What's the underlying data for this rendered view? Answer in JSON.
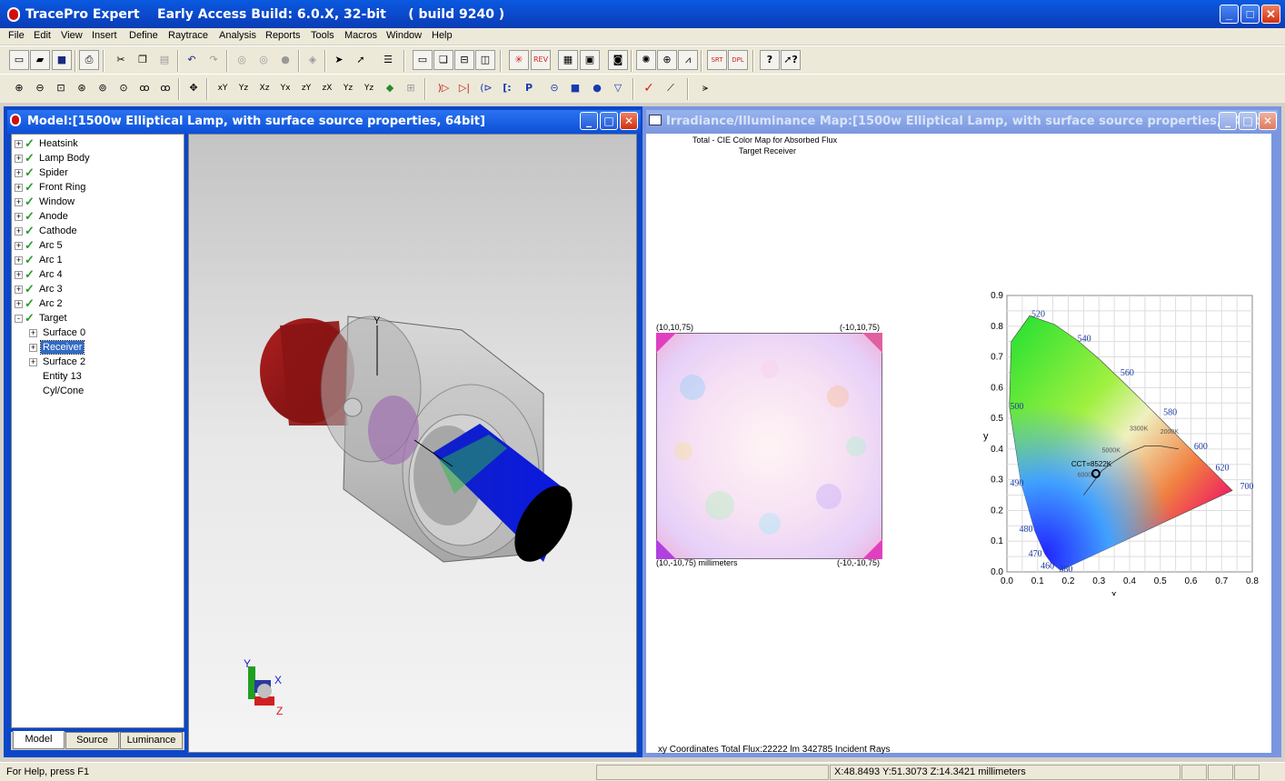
{
  "app": {
    "title": "TracePro Expert    Early Access Build: 6.0.X, 32-bit     ( build 9240 )"
  },
  "menu": [
    "File",
    "Edit",
    "View",
    "Insert",
    "Define",
    "Raytrace",
    "Analysis",
    "Reports",
    "Tools",
    "Macros",
    "Window",
    "Help"
  ],
  "toolbar1": [
    "new-icon",
    "open-icon",
    "save-icon",
    "print-icon",
    "cut-icon",
    "copy-icon",
    "paste-icon",
    "undo-icon",
    "redo-icon",
    "boolean-union-icon",
    "boolean-intersect-icon",
    "boolean-subtract-icon",
    "move-icon",
    "select-icon",
    "select-surface-icon",
    "properties-icon",
    "window-icon",
    "cascade-icon",
    "tile-horizontal-icon",
    "tile-vertical-icon",
    "trace-rays-icon",
    "reverse-ray-icon",
    "grid-icon",
    "raytrace-icon",
    "irradiance-icon",
    "analysis-icon",
    "target-icon",
    "chart-icon",
    "srt-icon",
    "dpl-icon",
    "help-icon",
    "context-help-icon"
  ],
  "toolbar2": [
    "zoom-in-icon",
    "zoom-out-icon",
    "zoom-window-icon",
    "zoom-all-icon",
    "zoom-fit-icon",
    "zoom-selected-icon",
    "glasses-icon",
    "glasses-stereo-icon",
    "pan-icon",
    "view-xy-icon",
    "view-yz-icon",
    "view-xz-icon",
    "view-yx-icon",
    "view-zy-icon",
    "view-zx-icon",
    "view-iso-icon",
    "view-iso2-icon",
    "render-icon",
    "disabled-icon",
    "lens-icon",
    "mirror-icon",
    "lens-group-icon",
    "bracket-icon",
    "prism-icon",
    "cylinder-icon",
    "block-icon",
    "sphere-icon",
    "cone-icon",
    "check-icon",
    "ruler-icon",
    "trim-icon"
  ],
  "tb2labels": {
    "xy": "xY",
    "yz": "Yz",
    "xz": "Xz",
    "yx": "Yx",
    "zy": "zY",
    "zx": "zX",
    "iso": "Yz",
    "iso2": "Yz",
    "bracket": "[:",
    "prism": "P"
  },
  "model_window": {
    "title": "Model:[1500w Elliptical Lamp, with surface source properties, 64bit]",
    "tree": [
      {
        "label": "Heatsink",
        "level": 0,
        "check": true,
        "expand": "+"
      },
      {
        "label": "Lamp Body",
        "level": 0,
        "check": true,
        "expand": "+"
      },
      {
        "label": "Spider",
        "level": 0,
        "check": true,
        "expand": "+"
      },
      {
        "label": "Front Ring",
        "level": 0,
        "check": true,
        "expand": "+"
      },
      {
        "label": "Window",
        "level": 0,
        "check": true,
        "expand": "+"
      },
      {
        "label": "Anode",
        "level": 0,
        "check": true,
        "expand": "+"
      },
      {
        "label": "Cathode",
        "level": 0,
        "check": true,
        "expand": "+"
      },
      {
        "label": "Arc 5",
        "level": 0,
        "check": true,
        "expand": "+"
      },
      {
        "label": "Arc 1",
        "level": 0,
        "check": true,
        "expand": "+"
      },
      {
        "label": "Arc 4",
        "level": 0,
        "check": true,
        "expand": "+"
      },
      {
        "label": "Arc 3",
        "level": 0,
        "check": true,
        "expand": "+"
      },
      {
        "label": "Arc 2",
        "level": 0,
        "check": true,
        "expand": "+"
      },
      {
        "label": "Target",
        "level": 0,
        "check": true,
        "expand": "-"
      },
      {
        "label": "Surface 0",
        "level": 1,
        "check": false,
        "expand": "+"
      },
      {
        "label": "Receiver",
        "level": 1,
        "check": false,
        "expand": "+",
        "selected": true
      },
      {
        "label": "Surface 2",
        "level": 1,
        "check": false,
        "expand": "+"
      },
      {
        "label": "Entity 13",
        "level": 1,
        "check": false,
        "expand": ""
      },
      {
        "label": "Cyl/Cone",
        "level": 1,
        "check": false,
        "expand": ""
      }
    ],
    "tabs": [
      "Model",
      "Source",
      "Luminance"
    ],
    "axis_labels": {
      "y": "Y",
      "x": "X",
      "z": "Z"
    }
  },
  "irr_window": {
    "title": "Irradiance/Illuminance Map:[1500w Elliptical Lamp, with surface source properties, 64bit]",
    "heading1": "Total - CIE Color Map for Absorbed Flux",
    "heading2": "Target Receiver",
    "corner_tl": "(10,10,75)",
    "corner_tr": "(-10,10,75)",
    "corner_bl": "(10,-10,75) millimeters",
    "corner_br": "(-10,-10,75)",
    "footer": "xy Coordinates Total Flux:22222 lm 342785 Incident Rays"
  },
  "chart_data": {
    "type": "scatter",
    "xlabel": "x",
    "ylabel": "y",
    "xlim": [
      0.0,
      0.8
    ],
    "ylim": [
      0.0,
      0.9
    ],
    "xticks": [
      "0.0",
      "0.1",
      "0.2",
      "0.3",
      "0.4",
      "0.5",
      "0.6",
      "0.7",
      "0.8"
    ],
    "yticks": [
      "0.0",
      "0.1",
      "0.2",
      "0.3",
      "0.4",
      "0.5",
      "0.6",
      "0.7",
      "0.8",
      "0.9"
    ],
    "wavelength_labels": [
      {
        "text": "520",
        "x": 0.08,
        "y": 0.83
      },
      {
        "text": "540",
        "x": 0.23,
        "y": 0.75
      },
      {
        "text": "560",
        "x": 0.37,
        "y": 0.64
      },
      {
        "text": "580",
        "x": 0.51,
        "y": 0.51
      },
      {
        "text": "600",
        "x": 0.61,
        "y": 0.4
      },
      {
        "text": "620",
        "x": 0.68,
        "y": 0.33
      },
      {
        "text": "700",
        "x": 0.76,
        "y": 0.27
      },
      {
        "text": "490",
        "x": 0.01,
        "y": 0.28
      },
      {
        "text": "500",
        "x": 0.01,
        "y": 0.53
      },
      {
        "text": "480",
        "x": 0.04,
        "y": 0.13
      },
      {
        "text": "470",
        "x": 0.07,
        "y": 0.05
      },
      {
        "text": "460",
        "x": 0.11,
        "y": 0.01
      },
      {
        "text": "380",
        "x": 0.17,
        "y": 0.0
      }
    ],
    "cct_labels": [
      {
        "text": "3300K",
        "x": 0.4,
        "y": 0.46
      },
      {
        "text": "2000K",
        "x": 0.5,
        "y": 0.45
      },
      {
        "text": "5000K",
        "x": 0.31,
        "y": 0.39
      },
      {
        "text": "6000K",
        "x": 0.23,
        "y": 0.31
      }
    ],
    "point": {
      "x": 0.29,
      "y": 0.32,
      "label": "CCT=8522K"
    }
  },
  "status": {
    "help": "For Help, press F1",
    "coords": "X:48.8493 Y:51.3073 Z:14.3421 millimeters"
  }
}
